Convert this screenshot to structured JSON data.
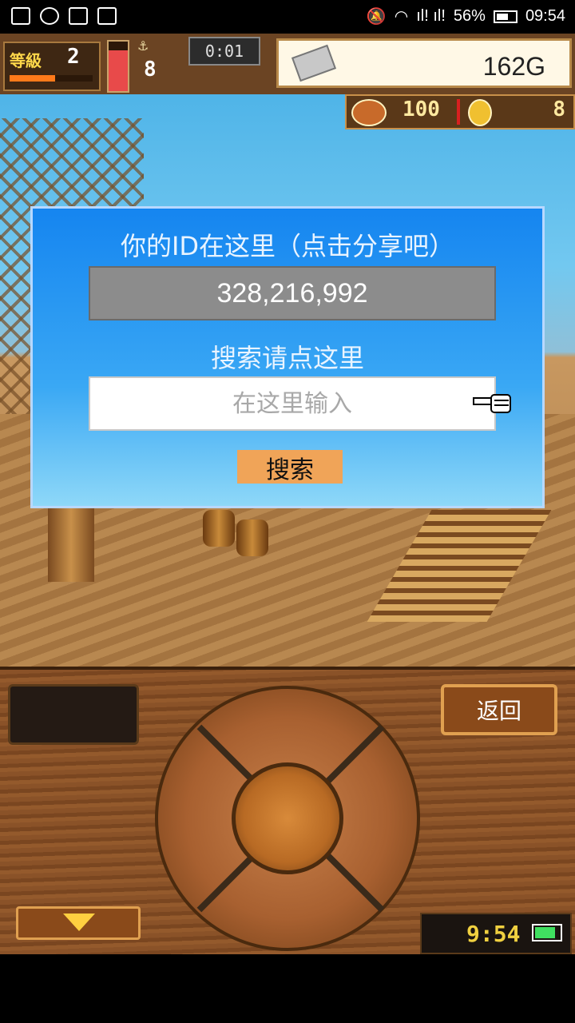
{
  "status_bar": {
    "battery_percent": "56%",
    "time": "09:54",
    "signal": "ıl! ıl!"
  },
  "hud": {
    "level_label": "等級",
    "level_value": "2",
    "xp_fraction": 0.55,
    "hp_fraction": 0.82,
    "rank_value": "8",
    "timer": "0:01",
    "gold": "162G",
    "food": "100",
    "coins": "8"
  },
  "dialog": {
    "title": "你的ID在这里（点击分享吧）",
    "id_value": "328,216,992",
    "search_label": "搜索请点这里",
    "search_placeholder": "在这里输入",
    "search_value": "",
    "search_button": "搜索"
  },
  "console": {
    "back_button": "返回",
    "clock": "9:54",
    "device_battery_fraction": 0.85
  },
  "colors": {
    "dialog_top": "#1585f0",
    "dialog_bottom": "#8ed8f8",
    "search_button": "#f0a458",
    "wood": "#8a5228"
  }
}
